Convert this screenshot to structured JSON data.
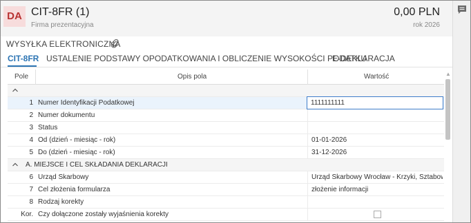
{
  "header": {
    "avatar": "DA",
    "title": "CIT-8FR (1)",
    "subtitle": "Firma prezentacyjna",
    "amount": "0,00 PLN",
    "year": "rok 2026"
  },
  "section": {
    "label": "WYSYŁKA ELEKTRONICZNA"
  },
  "tabs": [
    {
      "label": "CIT-8FR"
    },
    {
      "label": "USTALENIE PODSTAWY OPODATKOWANIA I OBLICZENIE WYSOKOŚCI PODATKU"
    },
    {
      "label": "E-DEKLARACJA"
    }
  ],
  "grid": {
    "columns": {
      "pole": "Pole",
      "opis": "Opis pola",
      "wartosc": "Wartość"
    },
    "rows": [
      {
        "num": "1",
        "desc": "Numer Identyfikacji Podatkowej",
        "value": "1111111111"
      },
      {
        "num": "2",
        "desc": "Numer dokumentu",
        "value": ""
      },
      {
        "num": "3",
        "desc": "Status",
        "value": ""
      },
      {
        "num": "4",
        "desc": "Od (dzień - miesiąc - rok)",
        "value": "01-01-2026"
      },
      {
        "num": "5",
        "desc": "Do (dzień - miesiąc - rok)",
        "value": "31-12-2026"
      },
      {
        "group": "A. MIEJSCE I CEL SKŁADANIA DEKLARACJI"
      },
      {
        "num": "6",
        "desc": "Urząd Skarbowy",
        "value": "Urząd Skarbowy Wrocław - Krzyki, Sztabowa..."
      },
      {
        "num": "7",
        "desc": "Cel złożenia formularza",
        "value": "złożenie informacji"
      },
      {
        "num": "8",
        "desc": "Rodzaj korekty",
        "value": ""
      },
      {
        "num": "Kor.",
        "desc": "Czy dołączone zostały wyjaśnienia korekty",
        "checkbox": false
      }
    ]
  },
  "icons": {
    "rail": "comment-icon",
    "attach": "paperclip-icon",
    "collapse": "chevron-up-icon"
  },
  "colors": {
    "accent": "#2c74b3",
    "avatar_bg": "#f7dcdc",
    "avatar_fg": "#b83232"
  }
}
